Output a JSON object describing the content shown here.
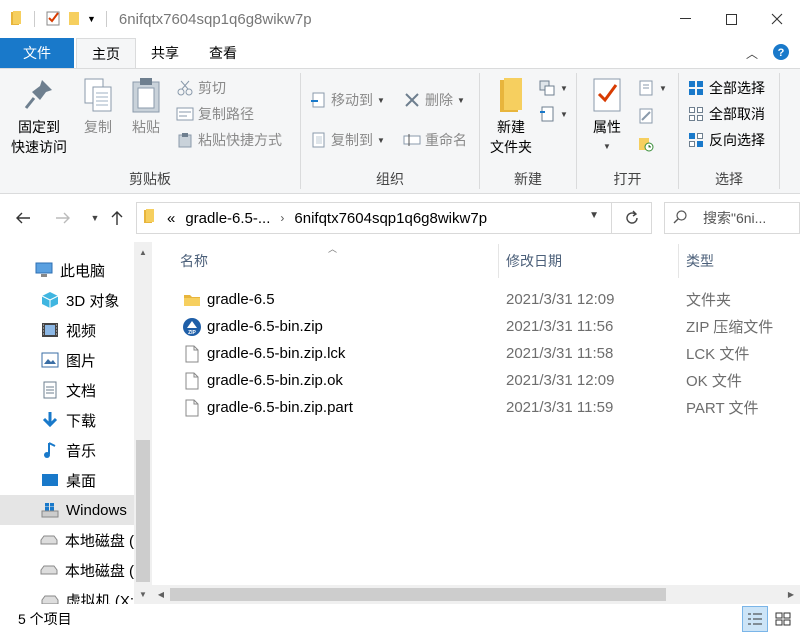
{
  "window": {
    "title": "6nifqtx7604sqp1q6g8wikw7p"
  },
  "tabs": {
    "file": "文件",
    "home": "主页",
    "share": "共享",
    "view": "查看"
  },
  "ribbon": {
    "clipboard": {
      "label": "剪贴板",
      "pin": "固定到\n快速访问",
      "pin_l1": "固定到",
      "pin_l2": "快速访问",
      "copy": "复制",
      "paste": "粘贴",
      "cut": "剪切",
      "copy_path": "复制路径",
      "paste_shortcut": "粘贴快捷方式"
    },
    "organize": {
      "label": "组织",
      "move_to": "移动到",
      "copy_to": "复制到",
      "delete": "删除",
      "rename": "重命名"
    },
    "new": {
      "label": "新建",
      "new_folder_l1": "新建",
      "new_folder_l2": "文件夹"
    },
    "open": {
      "label": "打开",
      "properties": "属性"
    },
    "select": {
      "label": "选择",
      "select_all": "全部选择",
      "select_none": "全部取消",
      "invert": "反向选择"
    }
  },
  "address": {
    "overflow": "«",
    "crumb1": "gradle-6.5-...",
    "crumb2": "6nifqtx7604sqp1q6g8wikw7p",
    "search_placeholder": "搜索\"6ni..."
  },
  "nav": {
    "items": [
      {
        "label": "此电脑",
        "icon": "pc-icon"
      },
      {
        "label": "3D 对象",
        "icon": "3d-objects-icon"
      },
      {
        "label": "视频",
        "icon": "video-icon"
      },
      {
        "label": "图片",
        "icon": "pictures-icon"
      },
      {
        "label": "文档",
        "icon": "documents-icon"
      },
      {
        "label": "下载",
        "icon": "download-icon"
      },
      {
        "label": "音乐",
        "icon": "music-icon"
      },
      {
        "label": "桌面",
        "icon": "desktop-icon"
      },
      {
        "label": "Windows",
        "icon": "windows-drive-icon"
      },
      {
        "label": "本地磁盘 (",
        "icon": "drive-icon"
      },
      {
        "label": "本地磁盘 (",
        "icon": "drive-icon"
      },
      {
        "label": "虚拟机 (X:",
        "icon": "drive-icon"
      }
    ]
  },
  "columns": {
    "name": "名称",
    "date": "修改日期",
    "type": "类型"
  },
  "files": [
    {
      "name": "gradle-6.5",
      "date": "2021/3/31 12:09",
      "type": "文件夹",
      "icon": "folder-icon"
    },
    {
      "name": "gradle-6.5-bin.zip",
      "date": "2021/3/31 11:56",
      "type": "ZIP 压缩文件",
      "icon": "zip-icon"
    },
    {
      "name": "gradle-6.5-bin.zip.lck",
      "date": "2021/3/31 11:58",
      "type": "LCK 文件",
      "icon": "file-icon"
    },
    {
      "name": "gradle-6.5-bin.zip.ok",
      "date": "2021/3/31 12:09",
      "type": "OK 文件",
      "icon": "file-icon"
    },
    {
      "name": "gradle-6.5-bin.zip.part",
      "date": "2021/3/31 11:59",
      "type": "PART 文件",
      "icon": "file-icon"
    }
  ],
  "status": {
    "count": "5 个项目"
  },
  "colors": {
    "accent": "#1979ca",
    "folder": "#e8b53c",
    "selected": "#e5e5e5"
  }
}
